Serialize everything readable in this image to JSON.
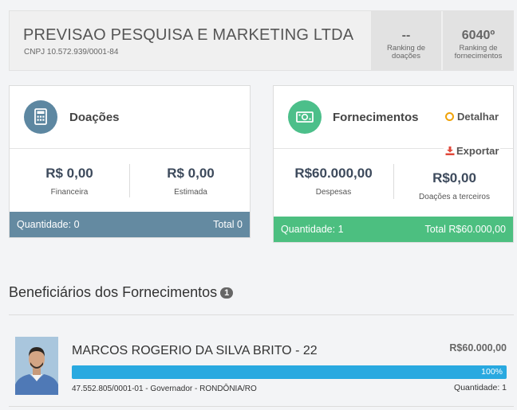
{
  "company": {
    "name": "PREVISAO PESQUISA E MARKETING LTDA",
    "cnpj": "CNPJ 10.572.939/0001-84"
  },
  "rankings": {
    "donations": {
      "value": "--",
      "label": "Ranking de doações"
    },
    "supplies": {
      "value": "6040º",
      "label": "Ranking de fornecimentos"
    }
  },
  "donations_card": {
    "title": "Doações",
    "icon": "calculator-icon",
    "financial": {
      "value": "R$ 0,00",
      "label": "Financeira"
    },
    "estimated": {
      "value": "R$ 0,00",
      "label": "Estimada"
    },
    "footer": {
      "quantity": "Quantidade: 0",
      "total": "Total 0"
    }
  },
  "supplies_card": {
    "title": "Fornecimentos",
    "icon": "money-icon",
    "detail_label": "Detalhar",
    "export_label": "Exportar",
    "expenses": {
      "value": "R$60.000,00",
      "label": "Despesas"
    },
    "third_party": {
      "value": "R$0,00",
      "label": "Doações a terceiros"
    },
    "footer": {
      "quantity": "Quantidade: 1",
      "total": "Total R$60.000,00"
    }
  },
  "beneficiaries": {
    "title": "Beneficiários dos Fornecimentos",
    "count": "1",
    "items": [
      {
        "name": "MARCOS ROGERIO DA SILVA BRITO - 22",
        "amount": "R$60.000,00",
        "percent_label": "100%",
        "percent": 100,
        "info": "47.552.805/0001-01 - Governador - RONDÔNIA/RO",
        "quantity": "Quantidade: 1"
      }
    ]
  },
  "colors": {
    "donations_accent": "#648aa1",
    "supplies_accent": "#4cbf80",
    "progress": "#29a9e0",
    "detail_ring": "#f0a30a",
    "export_icon": "#e0483b"
  }
}
